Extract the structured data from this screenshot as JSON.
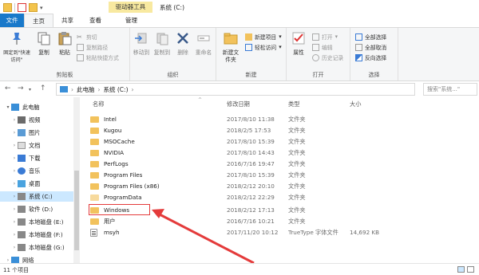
{
  "titlebar": {
    "context_tab": "驱动器工具",
    "window_title": "系统 (C:)"
  },
  "tabs": {
    "file": "文件",
    "home": "主页",
    "share": "共享",
    "view": "查看",
    "manage": "管理"
  },
  "ribbon": {
    "clipboard": {
      "pin": "固定到\"快速访问\"",
      "copy": "复制",
      "paste": "粘贴",
      "cut": "剪切",
      "copy_path": "复制路径",
      "paste_shortcut": "粘贴快捷方式",
      "title": "剪贴板"
    },
    "organize": {
      "move_to": "移动到",
      "copy_to": "复制到",
      "delete": "删除",
      "rename": "重命名",
      "title": "组织"
    },
    "new": {
      "new_folder": "新建文件夹",
      "new_item": "新建项目",
      "easy_access": "轻松访问",
      "title": "新建"
    },
    "open": {
      "properties": "属性",
      "open": "打开",
      "edit": "编辑",
      "history": "历史记录",
      "title": "打开"
    },
    "select": {
      "select_all": "全部选择",
      "select_none": "全部取消",
      "invert": "反向选择",
      "title": "选择"
    }
  },
  "address": {
    "this_pc": "此电脑",
    "drive": "系统 (C:)",
    "search_placeholder": "搜索\"系统...\""
  },
  "nav": {
    "items": [
      {
        "label": "此电脑"
      },
      {
        "label": "视频"
      },
      {
        "label": "图片"
      },
      {
        "label": "文档"
      },
      {
        "label": "下载"
      },
      {
        "label": "音乐"
      },
      {
        "label": "桌面"
      },
      {
        "label": "系统 (C:)"
      },
      {
        "label": "软件 (D:)"
      },
      {
        "label": "本地磁盘 (E:)"
      },
      {
        "label": "本地磁盘 (F:)"
      },
      {
        "label": "本地磁盘 (G:)"
      },
      {
        "label": "网络"
      }
    ]
  },
  "columns": {
    "name": "名称",
    "date": "修改日期",
    "type": "类型",
    "size": "大小"
  },
  "files": [
    {
      "name": "Intel",
      "date": "2017/8/10 11:38",
      "type": "文件夹",
      "size": ""
    },
    {
      "name": "Kugou",
      "date": "2018/2/5 17:53",
      "type": "文件夹",
      "size": ""
    },
    {
      "name": "MSOCache",
      "date": "2017/8/10 15:39",
      "type": "文件夹",
      "size": ""
    },
    {
      "name": "NVIDIA",
      "date": "2017/8/10 14:43",
      "type": "文件夹",
      "size": ""
    },
    {
      "name": "PerfLogs",
      "date": "2016/7/16 19:47",
      "type": "文件夹",
      "size": ""
    },
    {
      "name": "Program Files",
      "date": "2017/8/10 15:39",
      "type": "文件夹",
      "size": ""
    },
    {
      "name": "Program Files (x86)",
      "date": "2018/2/12 20:10",
      "type": "文件夹",
      "size": ""
    },
    {
      "name": "ProgramData",
      "date": "2018/2/12 22:29",
      "type": "文件夹",
      "size": ""
    },
    {
      "name": "Windows",
      "date": "2018/2/12 17:13",
      "type": "文件夹",
      "size": ""
    },
    {
      "name": "用户",
      "date": "2016/7/16 10:21",
      "type": "文件夹",
      "size": ""
    },
    {
      "name": "msyh",
      "date": "2017/11/20 10:12",
      "type": "TrueType 字体文件",
      "size": "14,692 KB"
    }
  ],
  "status": {
    "count": "11 个项目"
  },
  "colors": {
    "file_tab": "#1979ca",
    "context_tab": "#f8e9a0",
    "folder": "#f2c25c",
    "highlight": "#e43b3b",
    "selection": "#cce8ff"
  }
}
